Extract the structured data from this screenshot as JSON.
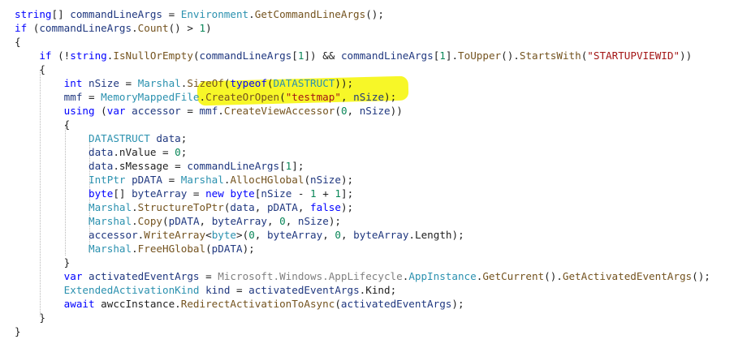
{
  "code_lines": [
    [
      {
        "t": "string",
        "c": "kw"
      },
      {
        "t": "[] ",
        "c": "plain"
      },
      {
        "t": "commandLineArgs",
        "c": "local"
      },
      {
        "t": " = ",
        "c": "plain"
      },
      {
        "t": "Environment",
        "c": "type"
      },
      {
        "t": ".",
        "c": "plain"
      },
      {
        "t": "GetCommandLineArgs",
        "c": "fn"
      },
      {
        "t": "();",
        "c": "plain"
      }
    ],
    [
      {
        "t": "if",
        "c": "kw"
      },
      {
        "t": " (",
        "c": "plain"
      },
      {
        "t": "commandLineArgs",
        "c": "local"
      },
      {
        "t": ".",
        "c": "plain"
      },
      {
        "t": "Count",
        "c": "fn"
      },
      {
        "t": "() > ",
        "c": "plain"
      },
      {
        "t": "1",
        "c": "num"
      },
      {
        "t": ")",
        "c": "plain"
      }
    ],
    [
      {
        "t": "{",
        "c": "plain"
      }
    ],
    [
      {
        "t": "    ",
        "c": "plain"
      },
      {
        "t": "if",
        "c": "kw"
      },
      {
        "t": " (!",
        "c": "plain"
      },
      {
        "t": "string",
        "c": "kw"
      },
      {
        "t": ".",
        "c": "plain"
      },
      {
        "t": "IsNullOrEmpty",
        "c": "fn"
      },
      {
        "t": "(",
        "c": "plain"
      },
      {
        "t": "commandLineArgs",
        "c": "local"
      },
      {
        "t": "[",
        "c": "plain"
      },
      {
        "t": "1",
        "c": "num"
      },
      {
        "t": "]) && ",
        "c": "plain"
      },
      {
        "t": "commandLineArgs",
        "c": "local"
      },
      {
        "t": "[",
        "c": "plain"
      },
      {
        "t": "1",
        "c": "num"
      },
      {
        "t": "].",
        "c": "plain"
      },
      {
        "t": "ToUpper",
        "c": "fn"
      },
      {
        "t": "().",
        "c": "plain"
      },
      {
        "t": "StartsWith",
        "c": "fn"
      },
      {
        "t": "(",
        "c": "plain"
      },
      {
        "t": "\"STARTUPVIEWID\"",
        "c": "str"
      },
      {
        "t": "))",
        "c": "plain"
      }
    ],
    [
      {
        "t": "    {",
        "c": "plain"
      }
    ],
    [
      {
        "t": "        ",
        "c": "plain"
      },
      {
        "t": "int",
        "c": "kw"
      },
      {
        "t": " ",
        "c": "plain"
      },
      {
        "t": "nSize",
        "c": "local"
      },
      {
        "t": " = ",
        "c": "plain"
      },
      {
        "t": "Marshal",
        "c": "type"
      },
      {
        "t": ".",
        "c": "plain"
      },
      {
        "t": "SizeOf",
        "c": "fn"
      },
      {
        "t": "(",
        "c": "plain"
      },
      {
        "t": "typeof",
        "c": "kw"
      },
      {
        "t": "(",
        "c": "plain"
      },
      {
        "t": "DATASTRUCT",
        "c": "type"
      },
      {
        "t": "));",
        "c": "plain"
      }
    ],
    [
      {
        "t": "        ",
        "c": "plain"
      },
      {
        "t": "mmf",
        "c": "local"
      },
      {
        "t": " = ",
        "c": "plain"
      },
      {
        "t": "MemoryMappedFile",
        "c": "type"
      },
      {
        "t": ".",
        "c": "plain"
      },
      {
        "t": "CreateOrOpen",
        "c": "fn"
      },
      {
        "t": "(",
        "c": "plain"
      },
      {
        "t": "\"testmap\"",
        "c": "str"
      },
      {
        "t": ", ",
        "c": "plain"
      },
      {
        "t": "nSize",
        "c": "local"
      },
      {
        "t": ");",
        "c": "plain"
      }
    ],
    [
      {
        "t": "        ",
        "c": "plain"
      },
      {
        "t": "using",
        "c": "kw"
      },
      {
        "t": " (",
        "c": "plain"
      },
      {
        "t": "var",
        "c": "kw"
      },
      {
        "t": " ",
        "c": "plain"
      },
      {
        "t": "accessor",
        "c": "local"
      },
      {
        "t": " = ",
        "c": "plain"
      },
      {
        "t": "mmf",
        "c": "local"
      },
      {
        "t": ".",
        "c": "plain"
      },
      {
        "t": "CreateViewAccessor",
        "c": "fn"
      },
      {
        "t": "(",
        "c": "plain"
      },
      {
        "t": "0",
        "c": "num"
      },
      {
        "t": ", ",
        "c": "plain"
      },
      {
        "t": "nSize",
        "c": "local"
      },
      {
        "t": "))",
        "c": "plain"
      }
    ],
    [
      {
        "t": "        {",
        "c": "plain"
      }
    ],
    [
      {
        "t": "            ",
        "c": "plain"
      },
      {
        "t": "DATASTRUCT",
        "c": "type"
      },
      {
        "t": " ",
        "c": "plain"
      },
      {
        "t": "data",
        "c": "local"
      },
      {
        "t": ";",
        "c": "plain"
      }
    ],
    [
      {
        "t": "            ",
        "c": "plain"
      },
      {
        "t": "data",
        "c": "local"
      },
      {
        "t": ".nValue = ",
        "c": "plain"
      },
      {
        "t": "0",
        "c": "num"
      },
      {
        "t": ";",
        "c": "plain"
      }
    ],
    [
      {
        "t": "            ",
        "c": "plain"
      },
      {
        "t": "data",
        "c": "local"
      },
      {
        "t": ".sMessage = ",
        "c": "plain"
      },
      {
        "t": "commandLineArgs",
        "c": "local"
      },
      {
        "t": "[",
        "c": "plain"
      },
      {
        "t": "1",
        "c": "num"
      },
      {
        "t": "];",
        "c": "plain"
      }
    ],
    [
      {
        "t": "            ",
        "c": "plain"
      },
      {
        "t": "IntPtr",
        "c": "type"
      },
      {
        "t": " ",
        "c": "plain"
      },
      {
        "t": "pDATA",
        "c": "local"
      },
      {
        "t": " = ",
        "c": "plain"
      },
      {
        "t": "Marshal",
        "c": "type"
      },
      {
        "t": ".",
        "c": "plain"
      },
      {
        "t": "AllocHGlobal",
        "c": "fn"
      },
      {
        "t": "(",
        "c": "plain"
      },
      {
        "t": "nSize",
        "c": "local"
      },
      {
        "t": ");",
        "c": "plain"
      }
    ],
    [
      {
        "t": "            ",
        "c": "plain"
      },
      {
        "t": "byte",
        "c": "kw"
      },
      {
        "t": "[] ",
        "c": "plain"
      },
      {
        "t": "byteArray",
        "c": "local"
      },
      {
        "t": " = ",
        "c": "plain"
      },
      {
        "t": "new",
        "c": "kw"
      },
      {
        "t": " ",
        "c": "plain"
      },
      {
        "t": "byte",
        "c": "kw"
      },
      {
        "t": "[",
        "c": "plain"
      },
      {
        "t": "nSize",
        "c": "local"
      },
      {
        "t": " - ",
        "c": "plain"
      },
      {
        "t": "1",
        "c": "num"
      },
      {
        "t": " + ",
        "c": "plain"
      },
      {
        "t": "1",
        "c": "num"
      },
      {
        "t": "];",
        "c": "plain"
      }
    ],
    [
      {
        "t": "            ",
        "c": "plain"
      },
      {
        "t": "Marshal",
        "c": "type"
      },
      {
        "t": ".",
        "c": "plain"
      },
      {
        "t": "StructureToPtr",
        "c": "fn"
      },
      {
        "t": "(",
        "c": "plain"
      },
      {
        "t": "data",
        "c": "local"
      },
      {
        "t": ", ",
        "c": "plain"
      },
      {
        "t": "pDATA",
        "c": "local"
      },
      {
        "t": ", ",
        "c": "plain"
      },
      {
        "t": "false",
        "c": "kw"
      },
      {
        "t": ");",
        "c": "plain"
      }
    ],
    [
      {
        "t": "            ",
        "c": "plain"
      },
      {
        "t": "Marshal",
        "c": "type"
      },
      {
        "t": ".",
        "c": "plain"
      },
      {
        "t": "Copy",
        "c": "fn"
      },
      {
        "t": "(",
        "c": "plain"
      },
      {
        "t": "pDATA",
        "c": "local"
      },
      {
        "t": ", ",
        "c": "plain"
      },
      {
        "t": "byteArray",
        "c": "local"
      },
      {
        "t": ", ",
        "c": "plain"
      },
      {
        "t": "0",
        "c": "num"
      },
      {
        "t": ", ",
        "c": "plain"
      },
      {
        "t": "nSize",
        "c": "local"
      },
      {
        "t": ");",
        "c": "plain"
      }
    ],
    [
      {
        "t": "            ",
        "c": "plain"
      },
      {
        "t": "accessor",
        "c": "local"
      },
      {
        "t": ".",
        "c": "plain"
      },
      {
        "t": "WriteArray",
        "c": "fn"
      },
      {
        "t": "<",
        "c": "plain"
      },
      {
        "t": "byte",
        "c": "type"
      },
      {
        "t": ">(",
        "c": "plain"
      },
      {
        "t": "0",
        "c": "num"
      },
      {
        "t": ", ",
        "c": "plain"
      },
      {
        "t": "byteArray",
        "c": "local"
      },
      {
        "t": ", ",
        "c": "plain"
      },
      {
        "t": "0",
        "c": "num"
      },
      {
        "t": ", ",
        "c": "plain"
      },
      {
        "t": "byteArray",
        "c": "local"
      },
      {
        "t": ".Length);",
        "c": "plain"
      }
    ],
    [
      {
        "t": "            ",
        "c": "plain"
      },
      {
        "t": "Marshal",
        "c": "type"
      },
      {
        "t": ".",
        "c": "plain"
      },
      {
        "t": "FreeHGlobal",
        "c": "fn"
      },
      {
        "t": "(",
        "c": "plain"
      },
      {
        "t": "pDATA",
        "c": "local"
      },
      {
        "t": ");",
        "c": "plain"
      }
    ],
    [
      {
        "t": "        }",
        "c": "plain"
      }
    ],
    [
      {
        "t": "        ",
        "c": "plain"
      },
      {
        "t": "var",
        "c": "kw"
      },
      {
        "t": " ",
        "c": "plain"
      },
      {
        "t": "activatedEventArgs",
        "c": "local"
      },
      {
        "t": " = ",
        "c": "plain"
      },
      {
        "t": "Microsoft.Windows.AppLifecycle",
        "c": "gray"
      },
      {
        "t": ".",
        "c": "plain"
      },
      {
        "t": "AppInstance",
        "c": "type"
      },
      {
        "t": ".",
        "c": "plain"
      },
      {
        "t": "GetCurrent",
        "c": "fn"
      },
      {
        "t": "().",
        "c": "plain"
      },
      {
        "t": "GetActivatedEventArgs",
        "c": "fn"
      },
      {
        "t": "();",
        "c": "plain"
      }
    ],
    [
      {
        "t": "        ",
        "c": "plain"
      },
      {
        "t": "ExtendedActivationKind",
        "c": "type"
      },
      {
        "t": " ",
        "c": "plain"
      },
      {
        "t": "kind",
        "c": "local"
      },
      {
        "t": " = ",
        "c": "plain"
      },
      {
        "t": "activatedEventArgs",
        "c": "local"
      },
      {
        "t": ".Kind;",
        "c": "plain"
      }
    ],
    [
      {
        "t": "        ",
        "c": "plain"
      },
      {
        "t": "await",
        "c": "kw"
      },
      {
        "t": " awccInstance.",
        "c": "plain"
      },
      {
        "t": "RedirectActivationToAsync",
        "c": "fn"
      },
      {
        "t": "(",
        "c": "plain"
      },
      {
        "t": "activatedEventArgs",
        "c": "local"
      },
      {
        "t": ");",
        "c": "plain"
      }
    ],
    [
      {
        "t": "    }",
        "c": "plain"
      }
    ],
    [
      {
        "t": "}",
        "c": "plain"
      }
    ]
  ],
  "colors": {
    "keyword": "#0000ff",
    "type": "#2b91af",
    "method": "#74531f",
    "string": "#a31515",
    "number": "#098658",
    "local": "#1f377f",
    "namespace": "#808080",
    "highlight": "#f7f71c"
  }
}
